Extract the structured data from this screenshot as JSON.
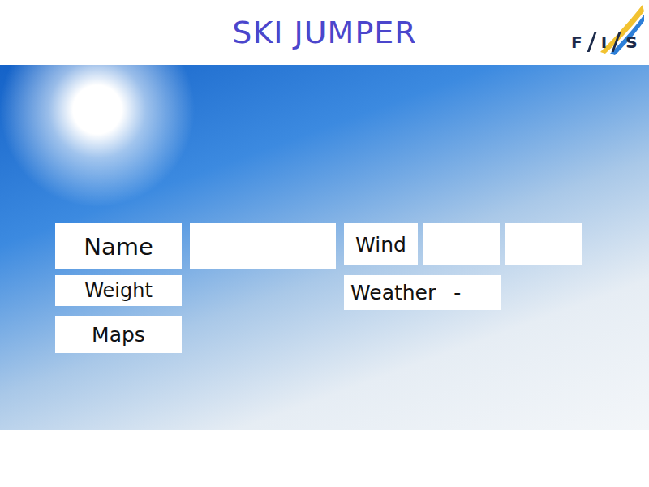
{
  "title": "SKI JUMPER",
  "logo": {
    "letters": [
      "F",
      "I",
      "S"
    ]
  },
  "form": {
    "name": {
      "label": "Name",
      "value": ""
    },
    "weight": {
      "label": "Weight"
    },
    "maps": {
      "label": "Maps"
    },
    "wind": {
      "label": "Wind",
      "values": [
        "",
        ""
      ]
    },
    "weather": {
      "label": "Weather",
      "value": "-"
    }
  }
}
